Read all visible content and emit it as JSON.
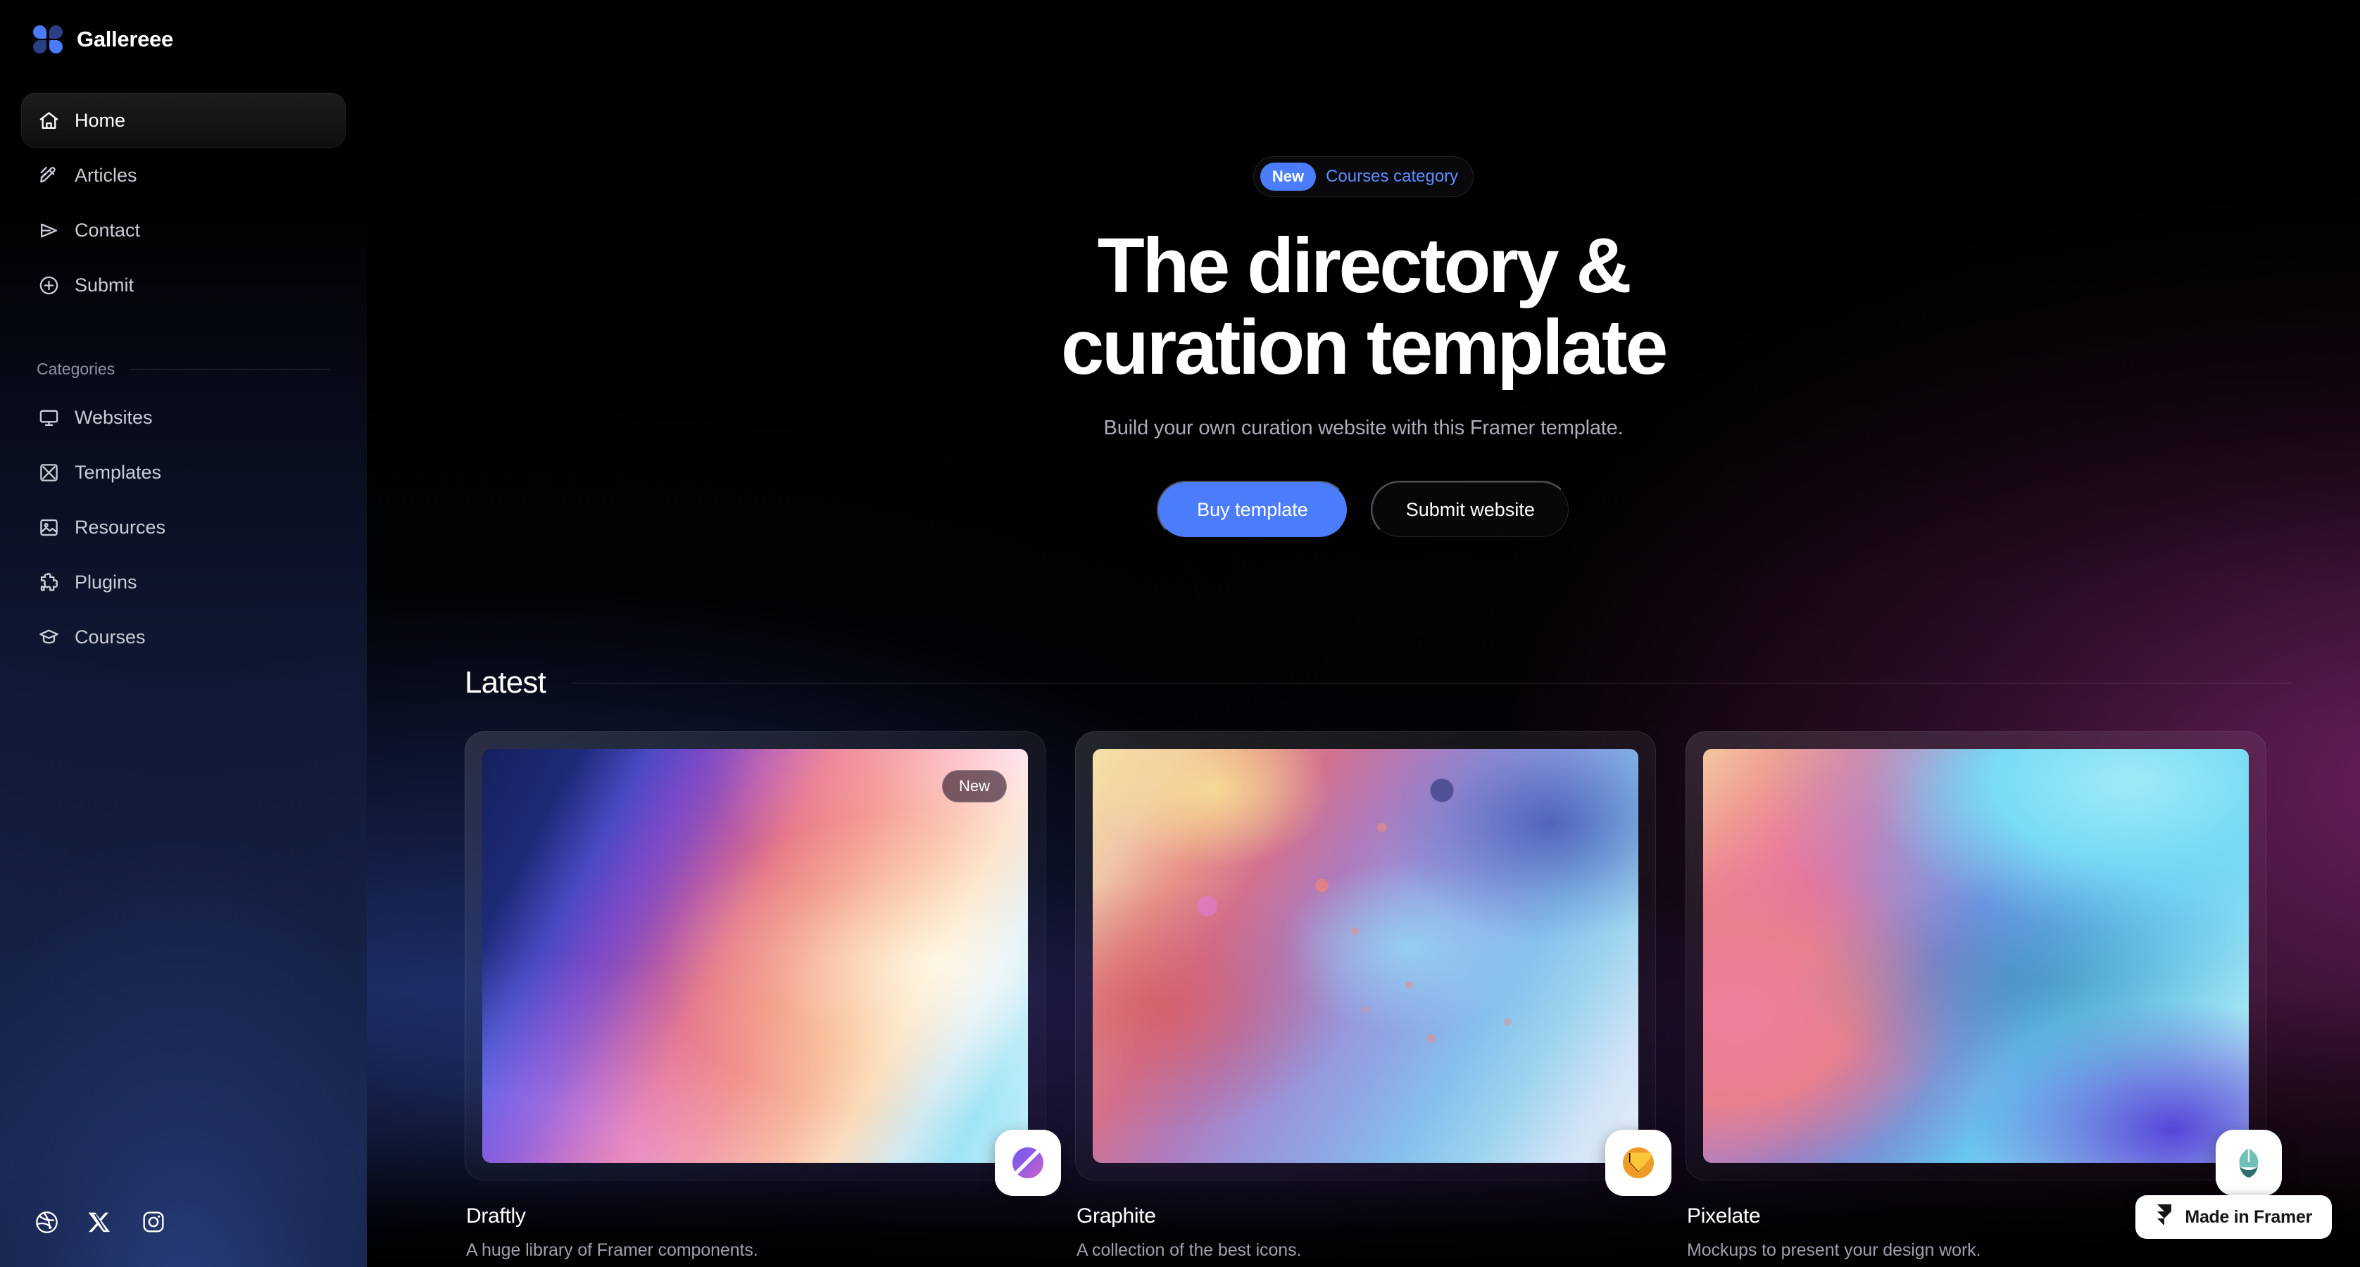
{
  "brand": {
    "name": "Gallereee",
    "logo_icon": "clover-logo-icon",
    "accent": "#4a7cfb"
  },
  "sidebar": {
    "nav": [
      {
        "label": "Home",
        "icon": "home-icon",
        "active": true
      },
      {
        "label": "Articles",
        "icon": "pencil-lines-icon",
        "active": false
      },
      {
        "label": "Contact",
        "icon": "send-paper-plane-icon",
        "active": false
      },
      {
        "label": "Submit",
        "icon": "plus-circle-icon",
        "active": false
      }
    ],
    "categories_label": "Categories",
    "categories": [
      {
        "label": "Websites",
        "icon": "monitor-icon"
      },
      {
        "label": "Templates",
        "icon": "frame-cross-icon"
      },
      {
        "label": "Resources",
        "icon": "image-icon"
      },
      {
        "label": "Plugins",
        "icon": "puzzle-piece-icon"
      },
      {
        "label": "Courses",
        "icon": "graduation-cap-icon"
      }
    ],
    "socials": [
      {
        "name": "dribbble-icon",
        "label": "Dribbble"
      },
      {
        "name": "x-twitter-icon",
        "label": "X"
      },
      {
        "name": "instagram-icon",
        "label": "Instagram"
      }
    ]
  },
  "hero": {
    "pill_badge": "New",
    "pill_text": "Courses category",
    "headline_line1": "The directory &",
    "headline_line2": "curation template",
    "subtitle": "Build your own curation website with this Framer template.",
    "primary_cta": "Buy template",
    "secondary_cta": "Submit website"
  },
  "latest": {
    "section_title": "Latest",
    "cards": [
      {
        "title": "Draftly",
        "description": "A huge library of Framer components.",
        "badge": "New",
        "logo_icon": "draftly-circle-slash-logo-icon",
        "art": "art1"
      },
      {
        "title": "Graphite",
        "description": "A collection of the best icons.",
        "badge": "",
        "logo_icon": "graphite-chevron-logo-icon",
        "art": "art2"
      },
      {
        "title": "Pixelate",
        "description": "Mockups to present your design work.",
        "badge": "",
        "logo_icon": "pixelate-leaf-logo-icon",
        "art": "art3"
      }
    ]
  },
  "footer_badge": {
    "label": "Made in Framer",
    "icon": "framer-logo-icon"
  }
}
